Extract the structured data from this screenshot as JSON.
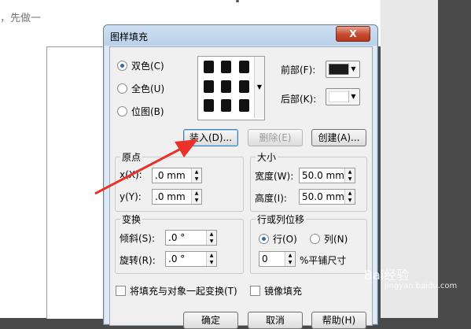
{
  "background": {
    "snippet_text": "，先做一"
  },
  "dialog": {
    "title": "图样填充",
    "close_label": "X",
    "pattern_type": {
      "two_color": "双色(C)",
      "full_color": "全色(U)",
      "bitmap": "位图(B)",
      "selected": "two_color"
    },
    "front_label": "前部(F):",
    "back_label": "后部(K):",
    "front_color": "#1a1a1a",
    "back_color": "#ffffff",
    "buttons": {
      "load": "装入(D)...",
      "delete": "删除(E)",
      "create": "创建(A)...",
      "ok": "确定",
      "cancel": "取消",
      "help": "帮助(H)"
    },
    "origin": {
      "title": "原点",
      "x_label": "x(X):",
      "x_value": ".0 mm",
      "y_label": "y(Y):",
      "y_value": ".0 mm"
    },
    "size": {
      "title": "大小",
      "width_label": "宽度(W):",
      "width_value": "50.0 mm",
      "height_label": "高度(I):",
      "height_value": "50.0 mm"
    },
    "transform": {
      "title": "变换",
      "skew_label": "倾斜(S):",
      "skew_value": ".0 °",
      "rotate_label": "旋转(R):",
      "rotate_value": ".0 °"
    },
    "offset": {
      "title": "行或列位移",
      "row_label": "行(O)",
      "col_label": "列(N)",
      "selected": "row",
      "percent_value": "0",
      "percent_label": "%平铺尺寸"
    },
    "transform_with_object_label": "将填充与对象一起变换(T)",
    "mirror_fill_label": "镜像填充"
  },
  "annotation": {
    "arrow_color": "#e8322a"
  },
  "watermark": {
    "text": "Bai经验",
    "sub": "jingyan.baidu.com"
  }
}
